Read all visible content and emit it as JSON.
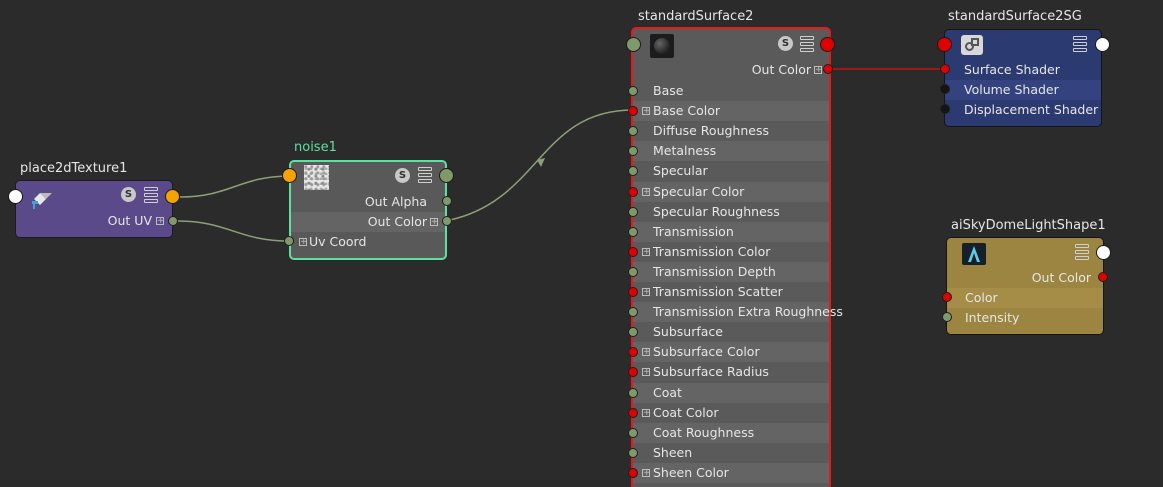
{
  "nodes": {
    "place2d": {
      "title": "place2dTexture1",
      "out_uv": "Out UV",
      "icon": "place2d-texture-icon",
      "color": "#5b4a8a"
    },
    "noise": {
      "title": "noise1",
      "out_alpha": "Out Alpha",
      "out_color": "Out Color",
      "uv_coord": "Uv Coord",
      "icon": "noise-texture-thumbnail",
      "title_color": "#5fe0a0"
    },
    "surface": {
      "title": "standardSurface2",
      "out_color": "Out Color",
      "icon": "standard-surface-sphere-icon",
      "border_color": "#e31b1b",
      "attributes": [
        {
          "label": "Base",
          "port": "green",
          "expand": false
        },
        {
          "label": "Base Color",
          "port": "red",
          "expand": true
        },
        {
          "label": "Diffuse Roughness",
          "port": "green",
          "expand": false
        },
        {
          "label": "Metalness",
          "port": "green",
          "expand": false
        },
        {
          "label": "Specular",
          "port": "green",
          "expand": false
        },
        {
          "label": "Specular Color",
          "port": "red",
          "expand": true
        },
        {
          "label": "Specular Roughness",
          "port": "green",
          "expand": false
        },
        {
          "label": "Transmission",
          "port": "green",
          "expand": false
        },
        {
          "label": "Transmission Color",
          "port": "red",
          "expand": true
        },
        {
          "label": "Transmission Depth",
          "port": "green",
          "expand": false
        },
        {
          "label": "Transmission Scatter",
          "port": "red",
          "expand": true
        },
        {
          "label": "Transmission Extra Roughness",
          "port": "green",
          "expand": false
        },
        {
          "label": "Subsurface",
          "port": "green",
          "expand": false
        },
        {
          "label": "Subsurface Color",
          "port": "red",
          "expand": true
        },
        {
          "label": "Subsurface Radius",
          "port": "red",
          "expand": true
        },
        {
          "label": "Coat",
          "port": "green",
          "expand": false
        },
        {
          "label": "Coat Color",
          "port": "red",
          "expand": true
        },
        {
          "label": "Coat Roughness",
          "port": "green",
          "expand": false
        },
        {
          "label": "Sheen",
          "port": "green",
          "expand": false
        },
        {
          "label": "Sheen Color",
          "port": "red",
          "expand": true
        }
      ]
    },
    "sg": {
      "title": "standardSurface2SG",
      "surface_shader": "Surface Shader",
      "volume_shader": "Volume Shader",
      "displacement_shader": "Displacement Shader",
      "icon": "shading-group-icon",
      "color": "#2c3a72"
    },
    "skydome": {
      "title": "aiSkyDomeLightShape1",
      "out_color": "Out Color",
      "color_label": "Color",
      "intensity_label": "Intensity",
      "icon": "arnold-logo-icon",
      "color": "#9c8540"
    }
  },
  "badge_s": "S",
  "colors": {
    "background": "#2b2b2b",
    "wire_green": "#8d9f78",
    "wire_red": "#c01515"
  }
}
